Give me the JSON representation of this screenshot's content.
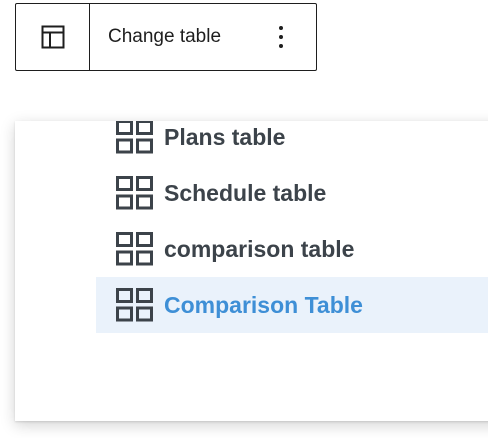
{
  "toolbar": {
    "block_icon": "table-icon",
    "change_label": "Change table",
    "more_icon": "vertical-ellipsis-icon"
  },
  "menu": {
    "item_icon": "grid-icon",
    "items": [
      {
        "label": "Plans table",
        "selected": false
      },
      {
        "label": "Schedule table",
        "selected": false
      },
      {
        "label": "comparison table",
        "selected": false
      },
      {
        "label": "Comparison Table",
        "selected": true
      }
    ],
    "colors": {
      "text": "#3c434a",
      "selected_text": "#3e8fd6",
      "selected_bg": "#eaf2fb"
    }
  }
}
